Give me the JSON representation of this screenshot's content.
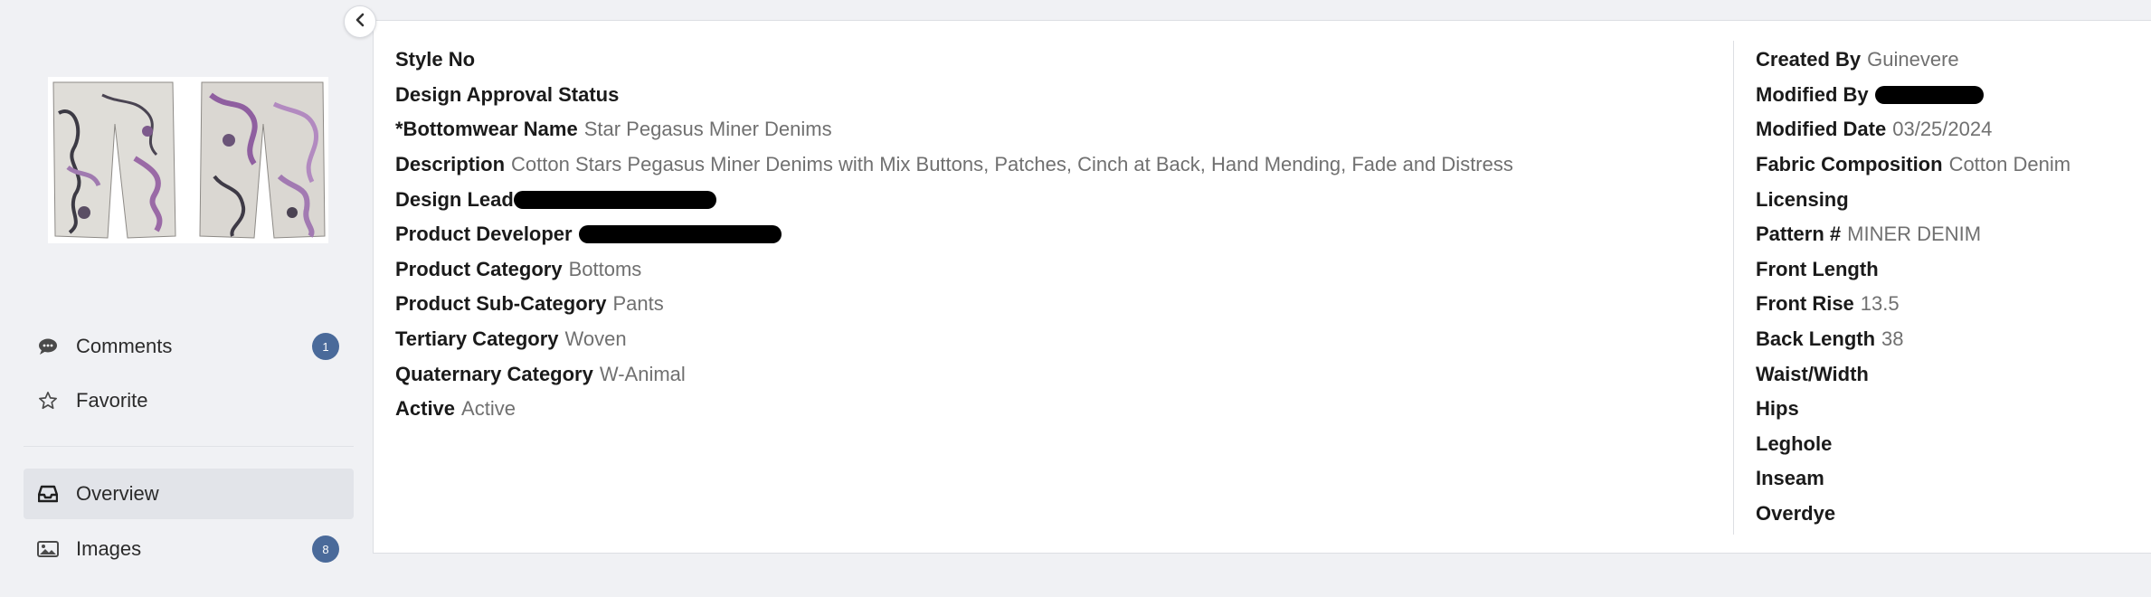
{
  "sidebar": {
    "comments": {
      "label": "Comments",
      "count": "1"
    },
    "favorite": {
      "label": "Favorite"
    },
    "overview": {
      "label": "Overview"
    },
    "images": {
      "label": "Images",
      "count": "8"
    }
  },
  "left_fields": [
    {
      "label": "Style No",
      "value": ""
    },
    {
      "label": "Design Approval Status",
      "value": ""
    },
    {
      "label": "*Bottomwear Name",
      "value": "Star Pegasus Miner Denims"
    },
    {
      "label": "Description",
      "value": "Cotton Stars Pegasus Miner Denims with Mix Buttons, Patches, Cinch at Back, Hand Mending, Fade and Distress"
    },
    {
      "label": "Design Lead",
      "value": ""
    },
    {
      "label": "Product Developer",
      "value": ""
    },
    {
      "label": "Product Category",
      "value": "Bottoms"
    },
    {
      "label": "Product Sub-Category",
      "value": "Pants"
    },
    {
      "label": "Tertiary Category",
      "value": "Woven"
    },
    {
      "label": "Quaternary Category",
      "value": "W-Animal"
    },
    {
      "label": "Active",
      "value": "Active"
    }
  ],
  "right_fields": [
    {
      "label": "Created By",
      "value": "Guinevere"
    },
    {
      "label": "Modified By",
      "value": ""
    },
    {
      "label": "Modified Date",
      "value": "03/25/2024"
    },
    {
      "label": "Fabric Composition",
      "value": "Cotton Denim"
    },
    {
      "label": "Licensing",
      "value": ""
    },
    {
      "label": "Pattern #",
      "value": "MINER DENIM"
    },
    {
      "label": "Front Length",
      "value": ""
    },
    {
      "label": "Front Rise",
      "value": "13.5"
    },
    {
      "label": "Back Length",
      "value": "38"
    },
    {
      "label": "Waist/Width",
      "value": ""
    },
    {
      "label": "Hips",
      "value": ""
    },
    {
      "label": "Leghole",
      "value": ""
    },
    {
      "label": "Inseam",
      "value": ""
    },
    {
      "label": "Overdye",
      "value": ""
    }
  ],
  "colors": {
    "badge": "#4a6a9a",
    "active_nav": "#e2e4e9",
    "label": "#1a1a1a",
    "value": "#707070"
  },
  "icons": {
    "collapse": "chevron-left-icon",
    "comments": "speech-bubble-icon",
    "favorite": "star-outline-icon",
    "overview": "inbox-icon",
    "images": "image-icon"
  }
}
